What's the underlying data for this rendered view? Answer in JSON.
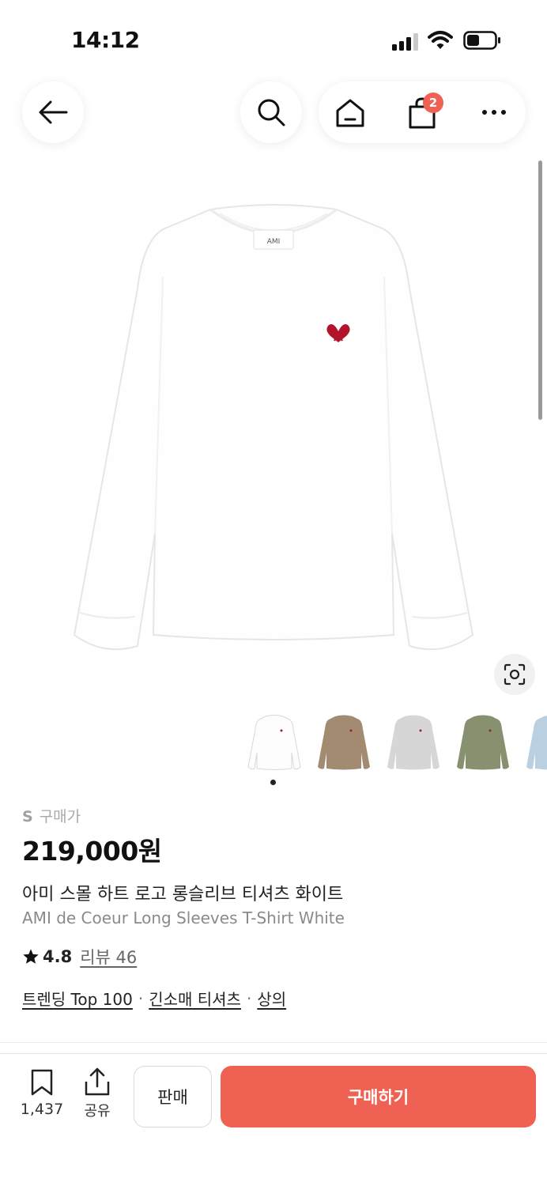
{
  "status_bar": {
    "time": "14:12"
  },
  "nav": {
    "cart_count": "2"
  },
  "product": {
    "size_label": "S",
    "price_label": "구매가",
    "price": "219,000원",
    "name_ko": "아미 스몰 하트 로고 롱슬리브 티셔츠 화이트",
    "name_en": "AMI de Coeur Long Sleeves T-Shirt White",
    "tag_label": "AMI",
    "thumbnail_colors": [
      "#ffffff",
      "#a38b72",
      "#d6d6d6",
      "#87906f",
      "#b9cfe2"
    ]
  },
  "rating": {
    "value": "4.8",
    "reviews": "리뷰 46"
  },
  "tags": [
    "트렌딩 Top 100",
    "긴소매 티셔츠",
    "상의"
  ],
  "tag_separator": "·",
  "bottom_bar": {
    "bookmark_count": "1,437",
    "share_label": "공유",
    "sell_label": "판매",
    "buy_label": "구매하기"
  },
  "colors": {
    "accent": "#ef6253",
    "logo_heart": "#b3142a"
  }
}
